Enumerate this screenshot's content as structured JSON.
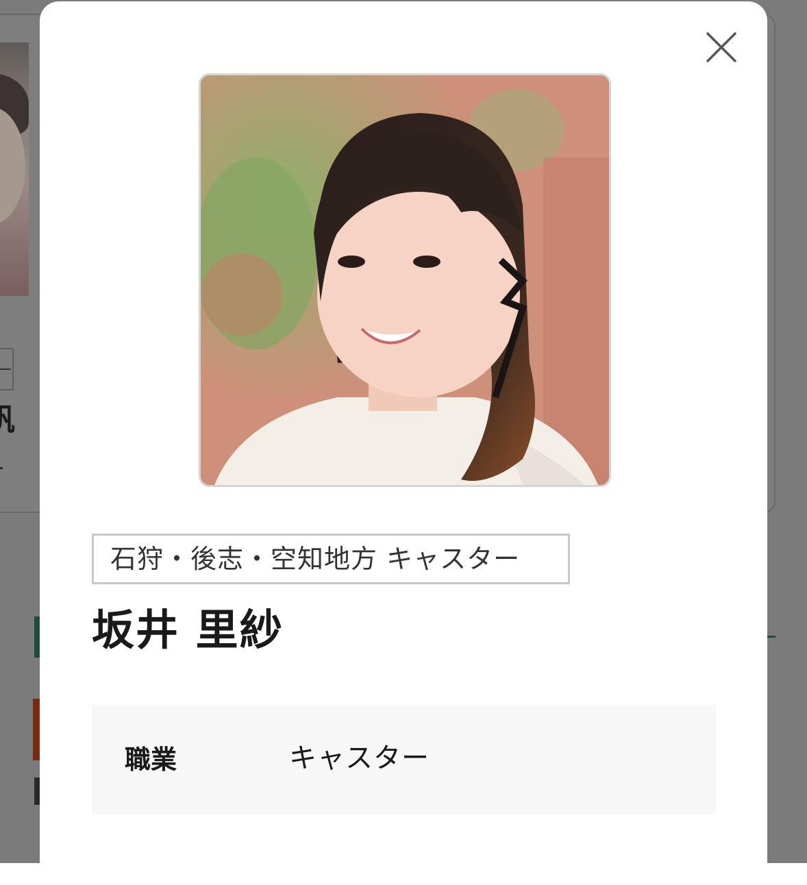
{
  "background_page": {
    "tag_fragment": "ー",
    "name_fragment": "帆"
  },
  "modal": {
    "close_icon": "close-icon",
    "photo_icon": "profile-photo",
    "category_tag": "石狩・後志・空知地方 キャスター",
    "name": "坂井 里紗",
    "details": [
      {
        "label": "職業",
        "value": "キャスター"
      }
    ]
  },
  "colors": {
    "overlay": "#7b7b7b",
    "modal_background": "#ffffff",
    "tag_border": "#c8c8c8",
    "info_panel_background": "#f7f7f7",
    "text": "#1a1a1a"
  }
}
